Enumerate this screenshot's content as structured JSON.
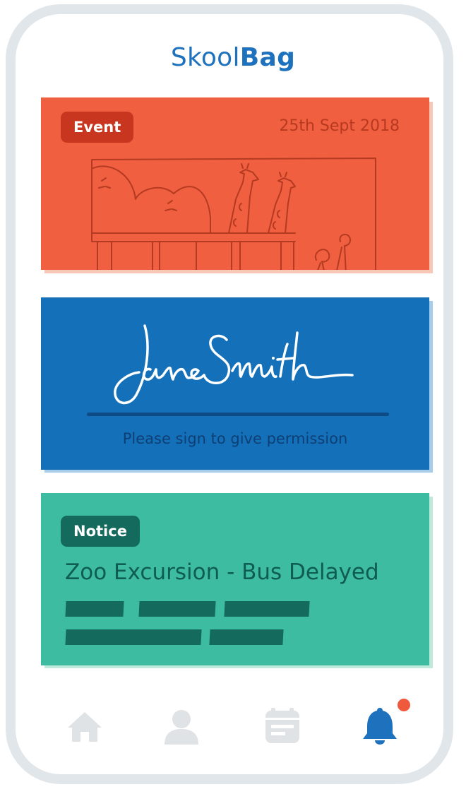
{
  "app": {
    "title_regular": "Skool",
    "title_bold": "Bag"
  },
  "event_card": {
    "badge": "Event",
    "date": "25th Sept 2018",
    "illustration": "zoo-giraffes-sketch",
    "color": "#f05f3f",
    "badge_color": "#c8361f"
  },
  "signature_card": {
    "signature": "Jane Smith",
    "caption": "Please sign to give permission",
    "color": "#1470b9"
  },
  "notice_card": {
    "badge": "Notice",
    "title": "Zoo Excursion - Bus Delayed",
    "color": "#3dbca1",
    "badge_color": "#136a5d"
  },
  "nav": {
    "items": [
      {
        "icon": "home-icon",
        "active": false
      },
      {
        "icon": "profile-icon",
        "active": false
      },
      {
        "icon": "calendar-icon",
        "active": false
      },
      {
        "icon": "bell-icon",
        "active": true,
        "has_notification": true
      }
    ],
    "active_color": "#1e72bd",
    "inactive_color": "#dfe3e6",
    "notification_color": "#ee5a3b"
  }
}
